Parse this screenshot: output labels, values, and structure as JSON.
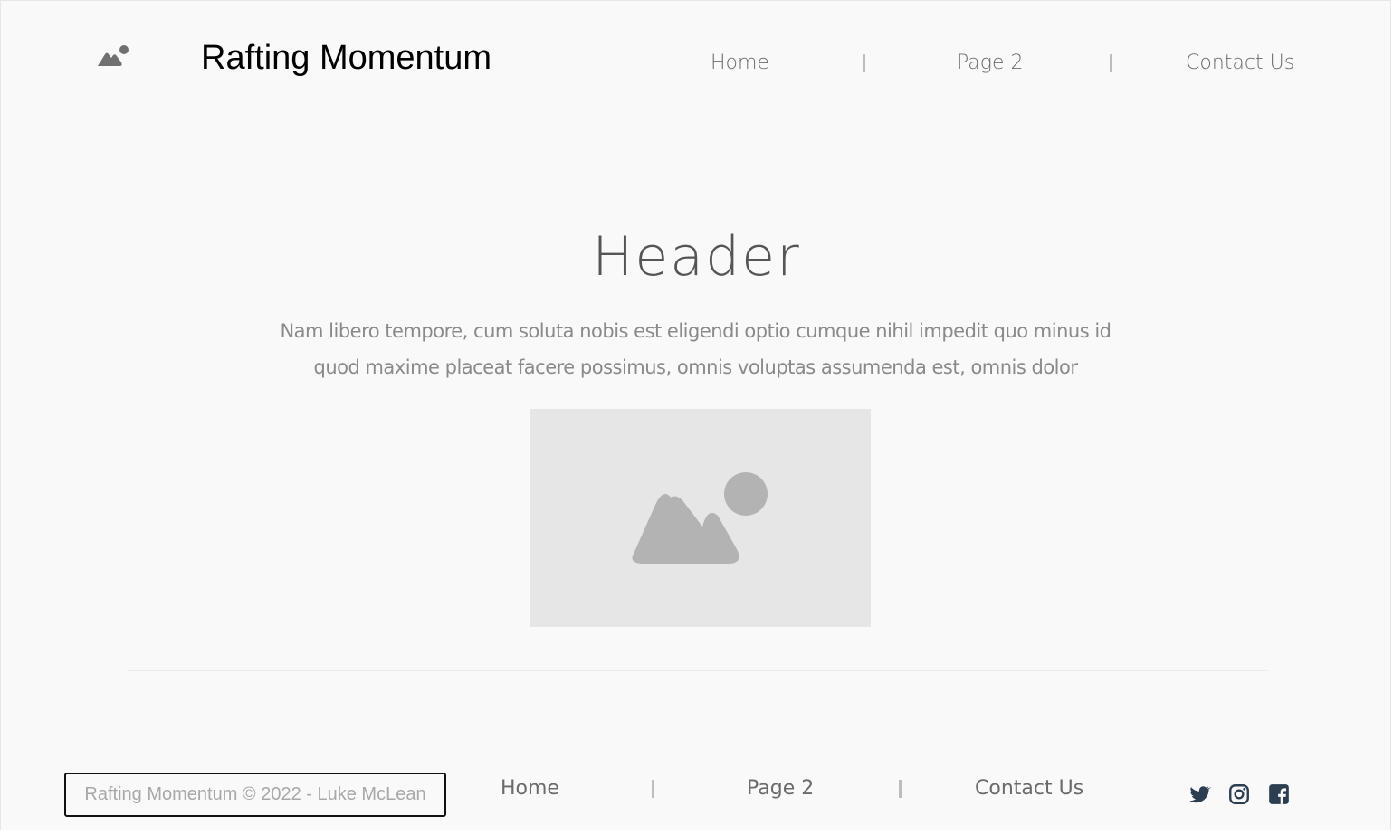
{
  "header": {
    "brand": "Rafting Momentum",
    "nav": [
      "Home",
      "Page 2",
      "Contact Us"
    ]
  },
  "hero": {
    "title": "Header",
    "text_line1": "Nam libero tempore, cum soluta nobis est eligendi optio cumque nihil impedit quo minus id",
    "text_line2": "quod maxime placeat facere possimus, omnis voluptas assumenda est, omnis dolor"
  },
  "footer": {
    "copyright": "Rafting Momentum © 2022 - Luke McLean",
    "nav": [
      "Home",
      "Page 2",
      "Contact Us"
    ],
    "social_icons": [
      "twitter-icon",
      "instagram-icon",
      "facebook-icon"
    ]
  },
  "colors": {
    "background": "#f9f9f9",
    "placeholder_bg": "#e6e6e6",
    "placeholder_icon": "#b3b3b3",
    "nav_text": "#6b6b6b",
    "social_icon": "#2c3e50"
  }
}
